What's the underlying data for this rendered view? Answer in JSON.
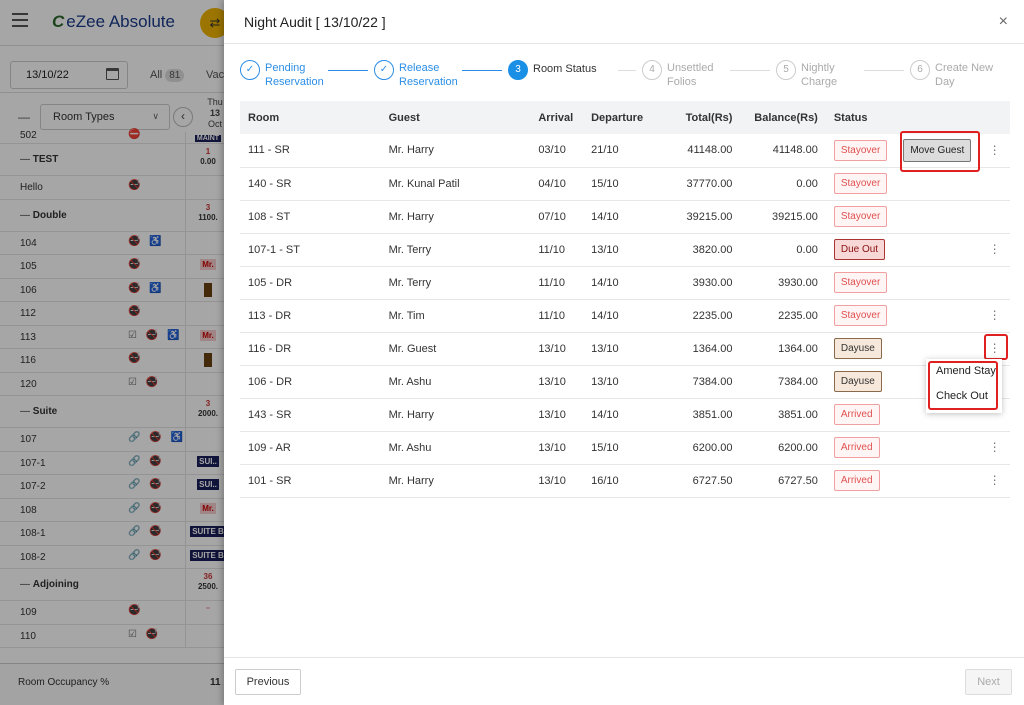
{
  "app": {
    "logo_text": "eZee Absolute",
    "date": "13/10/22",
    "all_label": "All",
    "all_count": "81",
    "vacant_label": "Vac",
    "room_types_label": "Room Types",
    "day_header": [
      "Thu",
      "13",
      "Oct"
    ],
    "rows": [
      {
        "type": "room",
        "name": "502",
        "icons": "⛔",
        "cell": "MAINT",
        "cell_style": "navy"
      },
      {
        "type": "group",
        "name": "TEST",
        "cell_top": "1",
        "cell_bottom": "0.00"
      },
      {
        "type": "room",
        "name": "Hello",
        "icons": "🚭"
      },
      {
        "type": "group",
        "name": "Double",
        "cell_top": "3",
        "cell_bottom": "1100."
      },
      {
        "type": "room",
        "name": "104",
        "icons": "🚭 ♿"
      },
      {
        "type": "room",
        "name": "105",
        "icons": "🚭",
        "cell": "Mr.",
        "cell_style": "red"
      },
      {
        "type": "room",
        "name": "106",
        "icons": "🚭 ♿",
        "cell_style": "brown"
      },
      {
        "type": "room",
        "name": "112",
        "icons": "🚭"
      },
      {
        "type": "room",
        "name": "113",
        "icons": "☑ 🚭 ♿",
        "cell": "Mr.",
        "cell_style": "red"
      },
      {
        "type": "room",
        "name": "116",
        "icons": "🚭",
        "cell_style": "brown"
      },
      {
        "type": "room",
        "name": "120",
        "icons": "☑ 🚭"
      },
      {
        "type": "group",
        "name": "Suite",
        "cell_top": "3",
        "cell_bottom": "2000."
      },
      {
        "type": "room",
        "name": "107",
        "icons": "🔗 🚭 ♿"
      },
      {
        "type": "room",
        "name": "107-1",
        "icons": "🔗 🚭",
        "cell": "SUI..",
        "cell_style": "navy"
      },
      {
        "type": "room",
        "name": "107-2",
        "icons": "🔗 🚭",
        "cell": "SUI..",
        "cell_style": "navy"
      },
      {
        "type": "room",
        "name": "108",
        "icons": "🔗 🚭",
        "cell": "Mr.",
        "cell_style": "red"
      },
      {
        "type": "room",
        "name": "108-1",
        "icons": "🔗 🚭",
        "cell": "SUITE B",
        "cell_style": "navy"
      },
      {
        "type": "room",
        "name": "108-2",
        "icons": "🔗 🚭",
        "cell": "SUITE B",
        "cell_style": "navy"
      },
      {
        "type": "group",
        "name": "Adjoining",
        "cell_top": "36",
        "cell_bottom": "2500."
      },
      {
        "type": "room",
        "name": "109",
        "icons": "🚭",
        "cell_style": "red"
      },
      {
        "type": "room",
        "name": "110",
        "icons": "☑ 🚭"
      }
    ],
    "occupancy_label": "Room Occupancy %",
    "occupancy_value": "11"
  },
  "modal": {
    "title": "Night Audit [ 13/10/22 ]",
    "close": "×",
    "steps": [
      {
        "label_1": "Pending",
        "label_2": "Reservation",
        "state": "done",
        "num": "✓"
      },
      {
        "label_1": "Release",
        "label_2": "Reservation",
        "state": "done",
        "num": "✓"
      },
      {
        "label_1": "Room Status",
        "label_2": "",
        "state": "active",
        "num": "3"
      },
      {
        "label_1": "Unsettled",
        "label_2": "Folios",
        "state": "pending",
        "num": "4"
      },
      {
        "label_1": "Nightly",
        "label_2": "Charge",
        "state": "pending",
        "num": "5"
      },
      {
        "label_1": "Create New",
        "label_2": "Day",
        "state": "pending",
        "num": "6"
      }
    ],
    "table": {
      "headers": [
        "Room",
        "Guest",
        "Arrival",
        "Departure",
        "Total(Rs)",
        "Balance(Rs)",
        "Status"
      ],
      "rows": [
        {
          "room": "111 - SR",
          "guest": "Mr. Harry",
          "arrival": "03/10",
          "departure": "21/10",
          "total": "41148.00",
          "balance": "41148.00",
          "status": "Stayover",
          "status_type": "stayover",
          "action": "Move Guest",
          "menu": true
        },
        {
          "room": "140 - SR",
          "guest": "Mr. Kunal Patil",
          "arrival": "04/10",
          "departure": "15/10",
          "total": "37770.00",
          "balance": "0.00",
          "status": "Stayover",
          "status_type": "stayover",
          "action": "",
          "menu": false
        },
        {
          "room": "108 - ST",
          "guest": "Mr. Harry",
          "arrival": "07/10",
          "departure": "14/10",
          "total": "39215.00",
          "balance": "39215.00",
          "status": "Stayover",
          "status_type": "stayover",
          "action": "",
          "menu": false
        },
        {
          "room": "107-1 - ST",
          "guest": "Mr. Terry",
          "arrival": "11/10",
          "departure": "13/10",
          "total": "3820.00",
          "balance": "0.00",
          "status": "Due Out",
          "status_type": "dueout",
          "action": "",
          "menu": true
        },
        {
          "room": "105 - DR",
          "guest": "Mr. Terry",
          "arrival": "11/10",
          "departure": "14/10",
          "total": "3930.00",
          "balance": "3930.00",
          "status": "Stayover",
          "status_type": "stayover",
          "action": "",
          "menu": false
        },
        {
          "room": "113 - DR",
          "guest": "Mr. Tim",
          "arrival": "11/10",
          "departure": "14/10",
          "total": "2235.00",
          "balance": "2235.00",
          "status": "Stayover",
          "status_type": "stayover",
          "action": "",
          "menu": true
        },
        {
          "room": "116 - DR",
          "guest": "Mr. Guest",
          "arrival": "13/10",
          "departure": "13/10",
          "total": "1364.00",
          "balance": "1364.00",
          "status": "Dayuse",
          "status_type": "dayuse",
          "action": "",
          "menu": true
        },
        {
          "room": "106 - DR",
          "guest": "Mr. Ashu",
          "arrival": "13/10",
          "departure": "13/10",
          "total": "7384.00",
          "balance": "7384.00",
          "status": "Dayuse",
          "status_type": "dayuse",
          "action": "",
          "menu": false
        },
        {
          "room": "143 - SR",
          "guest": "Mr. Harry",
          "arrival": "13/10",
          "departure": "14/10",
          "total": "3851.00",
          "balance": "3851.00",
          "status": "Arrived",
          "status_type": "arrived",
          "action": "",
          "menu": false
        },
        {
          "room": "109 - AR",
          "guest": "Mr. Ashu",
          "arrival": "13/10",
          "departure": "15/10",
          "total": "6200.00",
          "balance": "6200.00",
          "status": "Arrived",
          "status_type": "arrived",
          "action": "",
          "menu": true
        },
        {
          "room": "101 - SR",
          "guest": "Mr. Harry",
          "arrival": "13/10",
          "departure": "16/10",
          "total": "6727.50",
          "balance": "6727.50",
          "status": "Arrived",
          "status_type": "arrived",
          "action": "",
          "menu": true
        }
      ]
    },
    "dropdown": [
      "Amend Stay",
      "Check Out"
    ],
    "prev_label": "Previous",
    "next_label": "Next"
  }
}
